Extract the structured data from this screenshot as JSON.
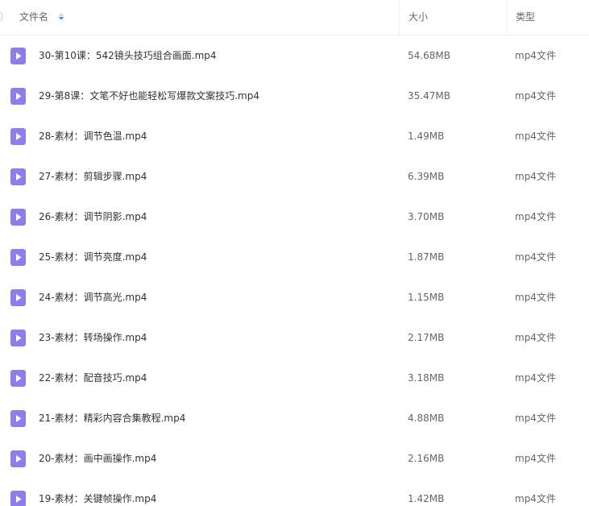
{
  "columns": {
    "name": "文件名",
    "size": "大小",
    "type": "类型"
  },
  "colors": {
    "video_icon": "#8f7cf0",
    "sort_active": "#06a7ff"
  },
  "icons": {
    "file": "video-file-icon",
    "sort": "sort-icon"
  },
  "files": [
    {
      "name": "30-第10课：542镜头技巧组合画面.mp4",
      "size": "54.68MB",
      "type": "mp4文件"
    },
    {
      "name": "29-第8课：文笔不好也能轻松写爆款文案技巧.mp4",
      "size": "35.47MB",
      "type": "mp4文件"
    },
    {
      "name": "28-素材：调节色温.mp4",
      "size": "1.49MB",
      "type": "mp4文件"
    },
    {
      "name": "27-素材：剪辑步骤.mp4",
      "size": "6.39MB",
      "type": "mp4文件"
    },
    {
      "name": "26-素材：调节阴影.mp4",
      "size": "3.70MB",
      "type": "mp4文件"
    },
    {
      "name": "25-素材：调节亮度.mp4",
      "size": "1.87MB",
      "type": "mp4文件"
    },
    {
      "name": "24-素材：调节高光.mp4",
      "size": "1.15MB",
      "type": "mp4文件"
    },
    {
      "name": "23-素材：转场操作.mp4",
      "size": "2.17MB",
      "type": "mp4文件"
    },
    {
      "name": "22-素材：配音技巧.mp4",
      "size": "3.18MB",
      "type": "mp4文件"
    },
    {
      "name": "21-素材：精彩内容合集教程.mp4",
      "size": "4.88MB",
      "type": "mp4文件"
    },
    {
      "name": "20-素材：画中画操作.mp4",
      "size": "2.16MB",
      "type": "mp4文件"
    },
    {
      "name": "19-素材：关键帧操作.mp4",
      "size": "1.42MB",
      "type": "mp4文件"
    }
  ]
}
